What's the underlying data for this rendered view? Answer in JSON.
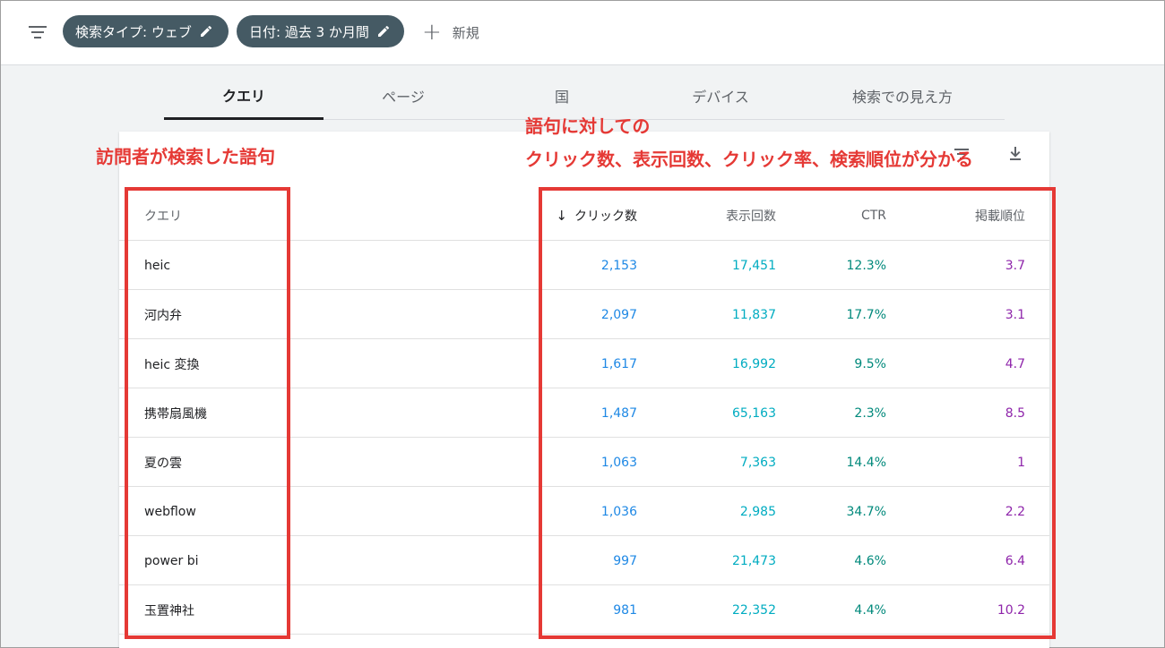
{
  "filters": {
    "chips": [
      {
        "label": "検索タイプ: ウェブ"
      },
      {
        "label": "日付: 過去 3 か月間"
      }
    ],
    "new_label": "新規"
  },
  "tabs": [
    {
      "label": "クエリ",
      "active": true
    },
    {
      "label": "ページ",
      "active": false
    },
    {
      "label": "国",
      "active": false
    },
    {
      "label": "デバイス",
      "active": false
    },
    {
      "label": "検索での見え方",
      "active": false
    }
  ],
  "table": {
    "headers": {
      "query": "クエリ",
      "clicks": "クリック数",
      "impressions": "表示回数",
      "ctr": "CTR",
      "position": "掲載順位"
    },
    "rows": [
      {
        "query": "heic",
        "clicks": "2,153",
        "impressions": "17,451",
        "ctr": "12.3%",
        "position": "3.7"
      },
      {
        "query": "河内弁",
        "clicks": "2,097",
        "impressions": "11,837",
        "ctr": "17.7%",
        "position": "3.1"
      },
      {
        "query": "heic 変換",
        "clicks": "1,617",
        "impressions": "16,992",
        "ctr": "9.5%",
        "position": "4.7"
      },
      {
        "query": "携帯扇風機",
        "clicks": "1,487",
        "impressions": "65,163",
        "ctr": "2.3%",
        "position": "8.5"
      },
      {
        "query": "夏の雲",
        "clicks": "1,063",
        "impressions": "7,363",
        "ctr": "14.4%",
        "position": "1"
      },
      {
        "query": "webflow",
        "clicks": "1,036",
        "impressions": "2,985",
        "ctr": "34.7%",
        "position": "2.2"
      },
      {
        "query": "power bi",
        "clicks": "997",
        "impressions": "21,473",
        "ctr": "4.6%",
        "position": "6.4"
      },
      {
        "query": "玉置神社",
        "clicks": "981",
        "impressions": "22,352",
        "ctr": "4.4%",
        "position": "10.2"
      }
    ]
  },
  "annotations": {
    "left": "訪問者が検索した語句",
    "right_line1": "語句に対しての",
    "right_line2": "クリック数、表示回数、クリック率、検索順位が分かる"
  },
  "colors": {
    "clicks": "#1e88e5",
    "impressions": "#00acc1",
    "ctr": "#00897b",
    "position": "#8e24aa",
    "annotation": "#e53935",
    "chip": "#455a64"
  }
}
